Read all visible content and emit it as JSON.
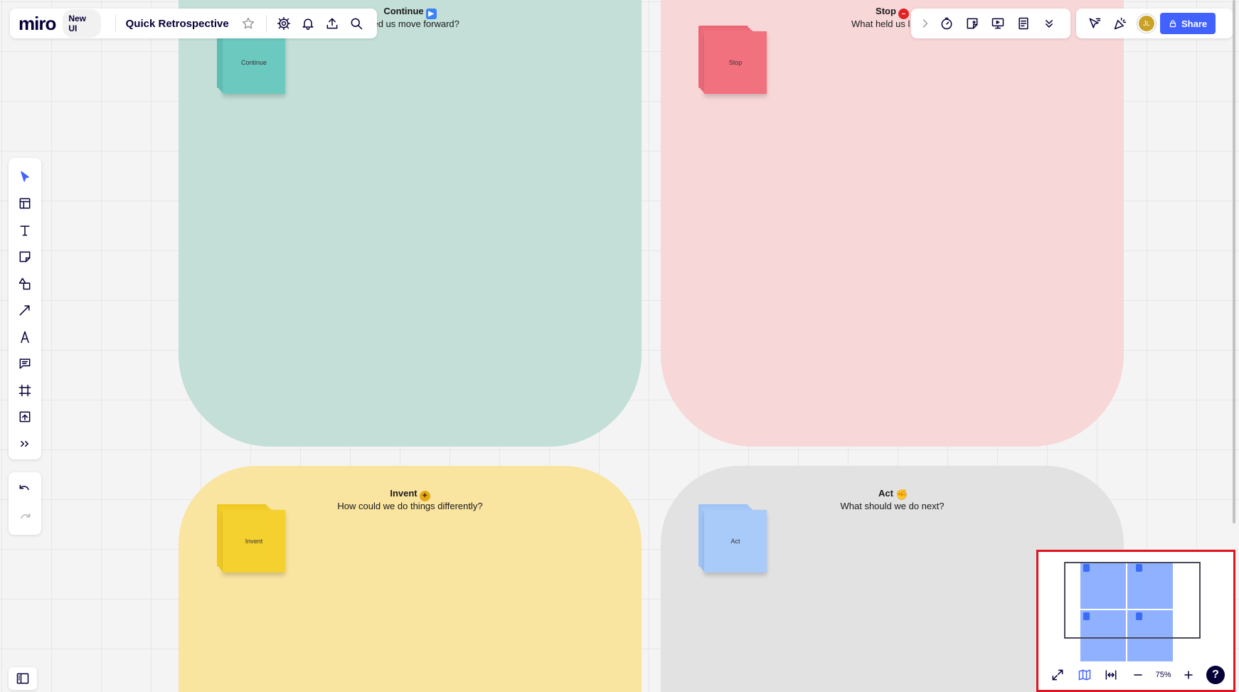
{
  "app": {
    "logo": "miro",
    "badge": "New UI",
    "board_title": "Quick Retrospective"
  },
  "quadrants": [
    {
      "id": "continue",
      "title": "Continue",
      "emoji_color": "#3b82f6",
      "emoji_glyph": "▶",
      "subtitle": "What helped us move forward?",
      "visible_subtitle": "elped us move forward?",
      "sticky_label": "Continue",
      "sticky_color": "#6cc9c0",
      "bg": "#c3dfd7"
    },
    {
      "id": "stop",
      "title": "Stop",
      "emoji_color": "#e02424",
      "emoji_glyph": "–",
      "subtitle": "What held us b",
      "visible_subtitle": "What held us l",
      "sticky_label": "Stop",
      "sticky_color": "#f2717f",
      "bg": "#f8d7d8"
    },
    {
      "id": "invent",
      "title": "Invent",
      "emoji_color": "#e6a817",
      "emoji_glyph": "✦",
      "subtitle": "How could we do things differently?",
      "sticky_label": "Invent",
      "sticky_color": "#f5d12f",
      "bg": "#f9e4a0"
    },
    {
      "id": "act",
      "title": "Act",
      "emoji_color": "#e6a817",
      "emoji_glyph": "✊",
      "subtitle": "What should we do next?",
      "sticky_label": "Act",
      "sticky_color": "#a9cbf9",
      "bg": "#e2e2e2"
    }
  ],
  "topbar": {
    "share_label": "Share",
    "avatar_initials": "JL",
    "icons_left": [
      "settings-icon",
      "bell-icon",
      "upload-icon",
      "search-icon"
    ],
    "icons_mid": [
      "chevron-right-icon",
      "timer-icon",
      "sticky-add-icon",
      "present-icon",
      "notes-icon",
      "more-down-icon"
    ],
    "icons_right": [
      "cursor-filter-icon",
      "celebrate-icon"
    ]
  },
  "tools": [
    "select-tool",
    "templates-tool",
    "text-tool",
    "sticky-note-tool",
    "shapes-tool",
    "connector-tool",
    "pen-tool",
    "comment-tool",
    "frame-tool",
    "upload-tool",
    "more-tools"
  ],
  "history": [
    "undo",
    "redo"
  ],
  "minimap": {
    "zoom": "75%"
  }
}
